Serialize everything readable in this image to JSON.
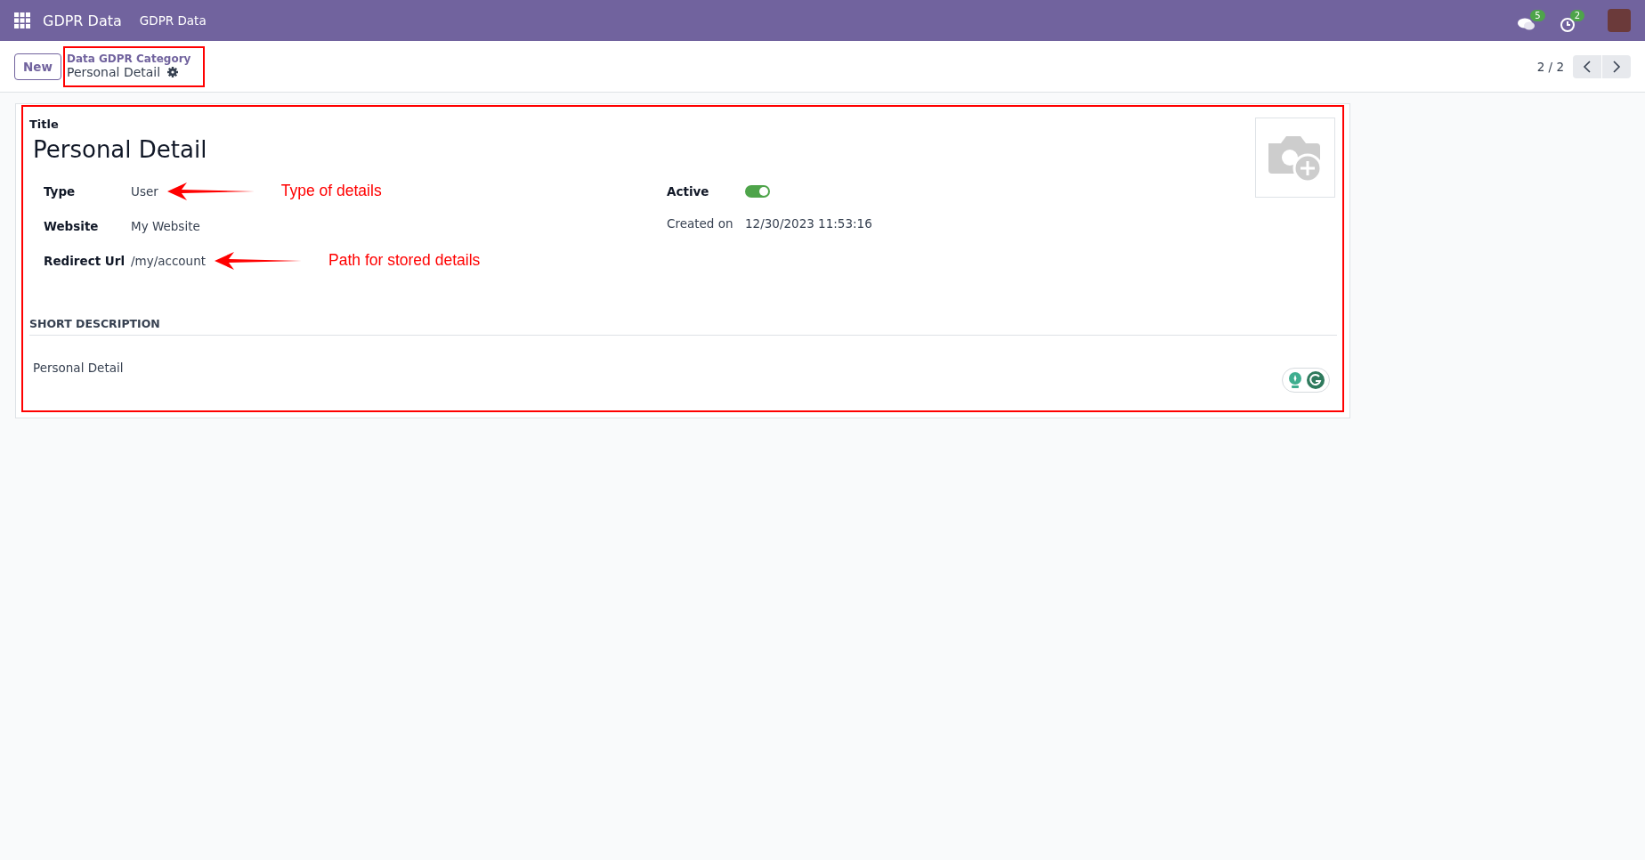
{
  "navbar": {
    "app_name": "GDPR Data",
    "menu": "GDPR Data",
    "messages_count": "5",
    "activities_count": "2"
  },
  "control_panel": {
    "new_button": "New",
    "breadcrumb": "Data GDPR Category",
    "record": "Personal Detail",
    "pager": "2 / 2"
  },
  "form": {
    "title_label": "Title",
    "title": "Personal Detail",
    "left_fields": [
      {
        "label": "Type",
        "value": "User",
        "annotation": "Type of details"
      },
      {
        "label": "Website",
        "value": "My Website"
      },
      {
        "label": "Redirect Url",
        "value": "/my/account",
        "annotation": "Path for stored details"
      }
    ],
    "active": {
      "label": "Active",
      "on": true
    },
    "created": {
      "label": "Created on",
      "value": "12/30/2023 11:53:16"
    },
    "section": "SHORT DESCRIPTION",
    "description": "Personal Detail"
  }
}
